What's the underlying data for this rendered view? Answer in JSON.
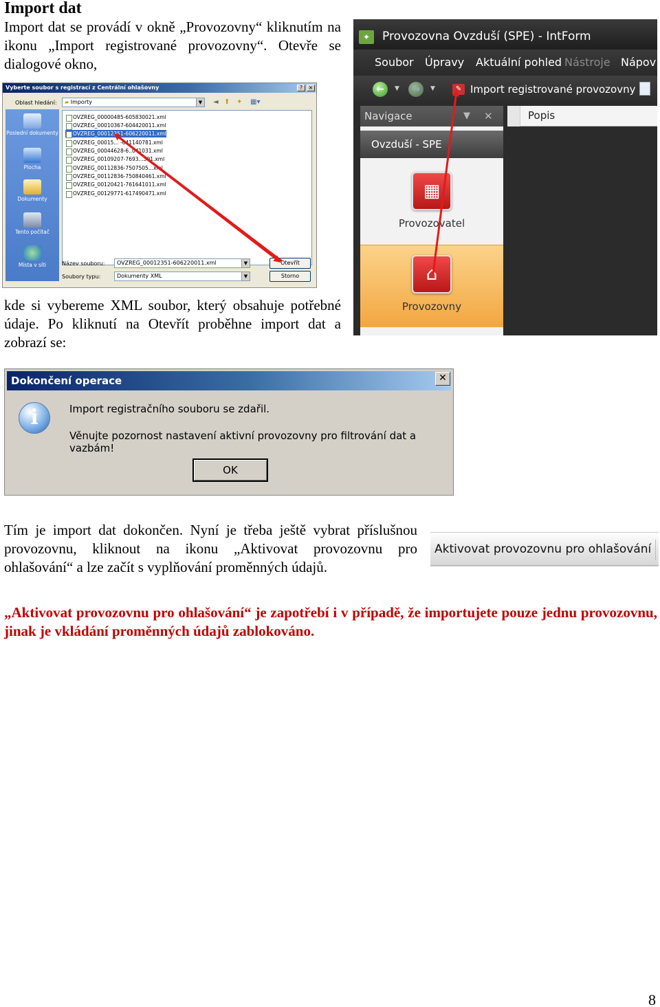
{
  "heading": "Import dat",
  "intro": "Import dat se provádí v okně „Provozovny“ kliknutím na ikonu „Import registrované provozovny“. Otevře se dialogové okno,",
  "after_dialog": "kde si vybereme XML soubor, který obsahuje potřebné údaje. Po kliknutí na Otevřít proběhne import dat a zobrazí se:",
  "after_confirm": "Tím je import dat dokončen. Nyní je třeba ještě vybrat příslušnou provozovnu, kliknout na ikonu „Aktivovat provozovnu pro ohlašování“ a lze začít s vyplňování proměnných údajů.",
  "warning": "„Aktivovat provozovnu pro ohlašování“ je zapotřebí i v případě, že importujete pouze jednu provozovnu, jinak je vkládání proměnných údajů zablokováno.",
  "page_number": "8",
  "file_dialog": {
    "title": "Vyberte soubor s registrací z Centrální ohlašovny",
    "help_btn": "?",
    "close_btn": "×",
    "look_in_label": "Oblast hledání:",
    "look_in_value": "Importy",
    "places": [
      "Poslední dokumenty",
      "Plocha",
      "Dokumenty",
      "Tento počítač",
      "Místa v síti"
    ],
    "files": [
      "OVZREG_00000485-605830021.xml",
      "OVZREG_00010367-604420011.xml",
      "OVZREG_00012351-606220011.xml",
      "OVZREG_00015... -641140781.xml",
      "OVZREG_00044628-6..041031.xml",
      "OVZREG_00109207-7693...391.xml",
      "OVZREG_00112836-7507505...xml",
      "OVZREG_00112836-750840461.xml",
      "OVZREG_00120421-761641011.xml",
      "OVZREG_00129771-617490471.xml"
    ],
    "filename_label": "Název souboru:",
    "filename_value": "OVZREG_00012351-606220011.xml",
    "filetype_label": "Soubory typu:",
    "filetype_value": "Dokumenty XML",
    "open_btn": "Otevřít",
    "cancel_btn": "Storno"
  },
  "app": {
    "title": "Provozovna Ovzduší (SPE) - IntForm",
    "menu": [
      "Soubor",
      "Úpravy",
      "Aktuální pohled",
      "Nástroje",
      "Nápov"
    ],
    "import_btn": "Import registrované provozovny",
    "nav_header": "Navigace",
    "section": "Ovzduší - SPE",
    "items": [
      "Provozovatel",
      "Provozovny"
    ],
    "popis": "Popis"
  },
  "complete_dialog": {
    "title": "Dokončení operace",
    "line1": "Import registračního souboru se zdařil.",
    "line2": "Věnujte pozornost nastavení aktivní provozovny pro filtrování dat a vazbám!",
    "ok": "OK"
  },
  "activate_button": "Aktivovat provozovnu pro ohlašování",
  "colors": {
    "arrow": "#e21b1b",
    "warning_text": "#c00000",
    "selection": "#316ac5"
  }
}
